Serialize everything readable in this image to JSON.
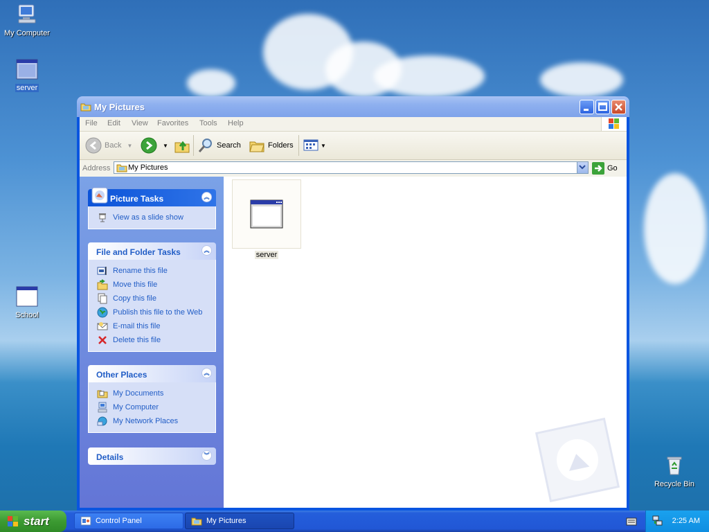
{
  "desktop": {
    "icons": [
      {
        "label": "My Computer",
        "icon": "my-computer-icon",
        "selected": false
      },
      {
        "label": "server",
        "icon": "window-file-icon",
        "selected": true
      },
      {
        "label": "School",
        "icon": "window-file-icon",
        "selected": false
      },
      {
        "label": "Recycle Bin",
        "icon": "recycle-bin-icon",
        "selected": false
      }
    ]
  },
  "window": {
    "title": "My Pictures",
    "menu": [
      "File",
      "Edit",
      "View",
      "Favorites",
      "Tools",
      "Help"
    ],
    "toolbar": {
      "back": "Back",
      "search": "Search",
      "folders": "Folders"
    },
    "address": {
      "label": "Address",
      "value": "My Pictures",
      "go": "Go"
    },
    "panels": {
      "picture_tasks": {
        "title": "Picture Tasks",
        "items": [
          "View as a slide show"
        ]
      },
      "file_folder_tasks": {
        "title": "File and Folder Tasks",
        "items": [
          "Rename this file",
          "Move this file",
          "Copy this file",
          "Publish this file to the Web",
          "E-mail this file",
          "Delete this file"
        ]
      },
      "other_places": {
        "title": "Other Places",
        "items": [
          "My Documents",
          "My Computer",
          "My Network Places"
        ]
      },
      "details": {
        "title": "Details"
      }
    },
    "files": [
      {
        "name": "server",
        "icon": "window-file-icon"
      }
    ]
  },
  "taskbar": {
    "start": "start",
    "buttons": [
      {
        "label": "Control Panel",
        "active": false
      },
      {
        "label": "My Pictures",
        "active": true
      }
    ],
    "clock": "2:25 AM"
  },
  "colors": {
    "link_blue": "#215dc6",
    "title_blue": "#0a55e0",
    "start_green": "#3c9a32"
  }
}
